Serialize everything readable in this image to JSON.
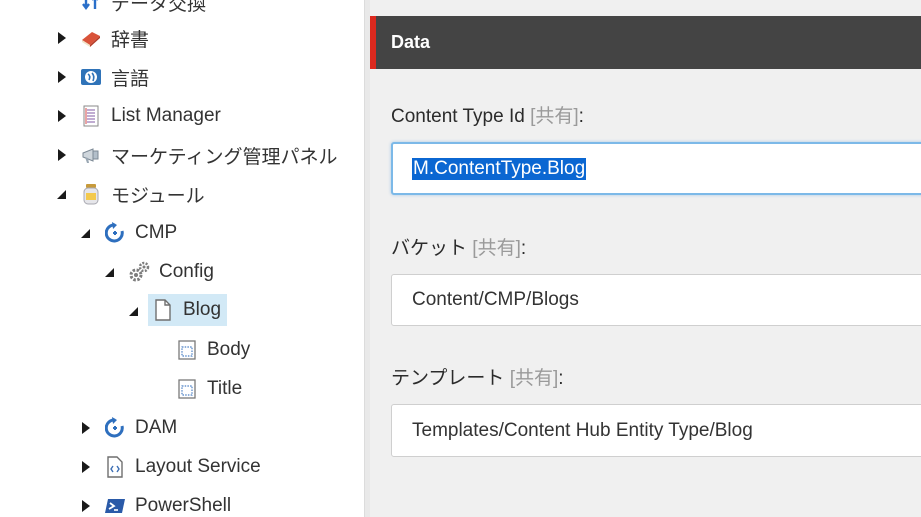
{
  "tree": {
    "items": [
      {
        "label": "データ交換",
        "icon": "data-exchange-icon",
        "state": "none"
      },
      {
        "label": "辞書",
        "icon": "dictionary-book-icon",
        "state": "collapsed"
      },
      {
        "label": "言語",
        "icon": "globe-language-icon",
        "state": "collapsed"
      },
      {
        "label": "List Manager",
        "icon": "list-manager-icon",
        "state": "collapsed"
      },
      {
        "label": "マーケティング管理パネル",
        "icon": "megaphone-icon",
        "state": "collapsed"
      },
      {
        "label": "モジュール",
        "icon": "jar-icon",
        "state": "expanded"
      },
      {
        "label": "CMP",
        "icon": "sync-icon",
        "state": "expanded"
      },
      {
        "label": "Config",
        "icon": "gears-icon",
        "state": "expanded"
      },
      {
        "label": "Blog",
        "icon": "document-icon",
        "state": "expanded",
        "selected": true
      },
      {
        "label": "Body",
        "icon": "template-field-icon",
        "state": "none"
      },
      {
        "label": "Title",
        "icon": "template-field-icon",
        "state": "none"
      },
      {
        "label": "DAM",
        "icon": "sync-icon",
        "state": "collapsed"
      },
      {
        "label": "Layout Service",
        "icon": "layout-code-icon",
        "state": "collapsed"
      },
      {
        "label": "PowerShell",
        "icon": "powershell-icon",
        "state": "collapsed"
      }
    ]
  },
  "editor": {
    "section_title": "Data",
    "accent_color": "#dc291e",
    "fields": [
      {
        "label": "Content Type Id",
        "shared": "[共有]",
        "colon": ":",
        "value": "M.ContentType.Blog"
      },
      {
        "label": "バケット",
        "shared": "[共有]",
        "colon": ":",
        "value": "Content/CMP/Blogs"
      },
      {
        "label": "テンプレート",
        "shared": "[共有]",
        "colon": ":",
        "value": "Templates/Content Hub Entity Type/Blog"
      }
    ]
  }
}
